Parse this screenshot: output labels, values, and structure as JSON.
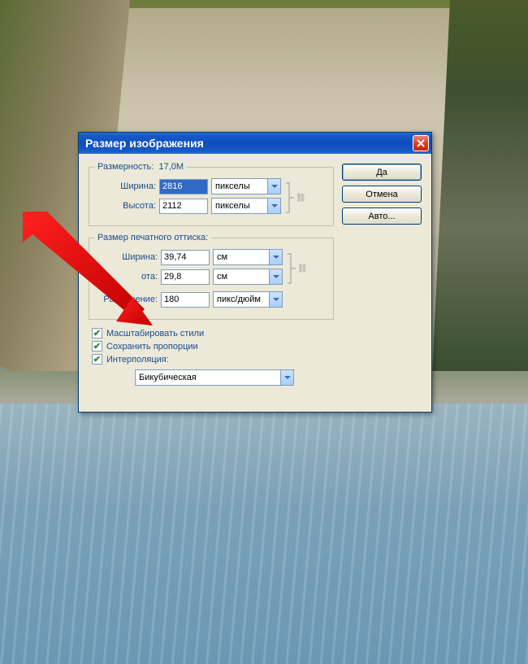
{
  "dialog": {
    "title": "Размер изображения",
    "pixel_dims": {
      "legend_prefix": "Размерность:",
      "size_text": "17,0M",
      "width_label": "Ширина:",
      "width_value": "2816",
      "height_label": "Высота:",
      "height_value": "2112",
      "unit": "пикселы"
    },
    "document": {
      "legend": "Размер печатного оттиска:",
      "width_label": "Ширина:",
      "width_value": "39,74",
      "width_unit": "см",
      "height_label": "ота:",
      "height_value": "29,8",
      "height_unit": "см",
      "resolution_label": "Разрешение:",
      "resolution_value": "180",
      "resolution_unit": "пикс/дюйм"
    },
    "checks": {
      "scale_styles": "Масштабировать стили",
      "constrain": "Сохранить пропорции",
      "resample": "Интерполяция:"
    },
    "interpolation": "Бикубическая",
    "buttons": {
      "ok": "Да",
      "cancel": "Отмена",
      "auto": "Авто..."
    }
  }
}
